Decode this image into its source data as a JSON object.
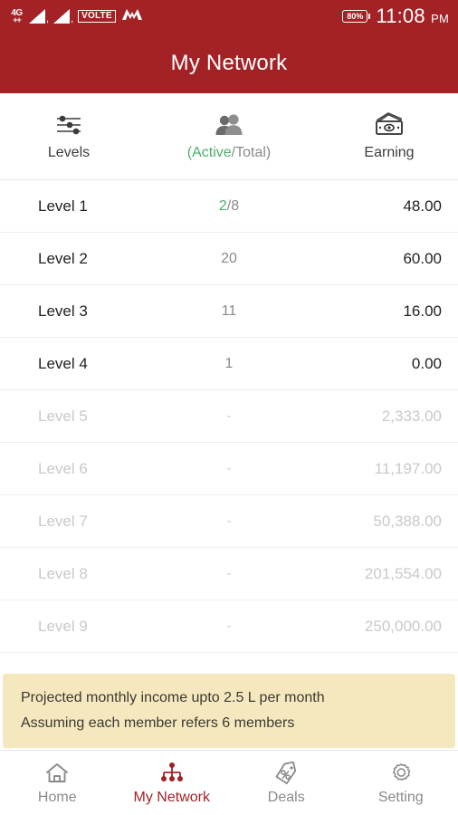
{
  "status_bar": {
    "network_type": "4G",
    "network_plus": "++",
    "volte_label": "VOLTE",
    "carrier_logo": "M",
    "battery_level": "80%",
    "time": "11:08",
    "time_period": "PM"
  },
  "header": {
    "title": "My Network"
  },
  "columns": {
    "levels": {
      "label": "Levels",
      "icon": "sliders-icon"
    },
    "active_total": {
      "active_label": "(Active",
      "total_label": "/Total)",
      "icon": "people-icon"
    },
    "earning": {
      "label": "Earning",
      "icon": "money-icon"
    }
  },
  "rows": [
    {
      "level": "Level 1",
      "count": "2",
      "count_sep": "/8",
      "earning": "48.00",
      "locked": false,
      "has_chevron": true
    },
    {
      "level": "Level 2",
      "count": "20",
      "count_sep": "",
      "earning": "60.00",
      "locked": false,
      "has_chevron": false
    },
    {
      "level": "Level 3",
      "count": "11",
      "count_sep": "",
      "earning": "16.00",
      "locked": false,
      "has_chevron": false
    },
    {
      "level": "Level 4",
      "count": "1",
      "count_sep": "",
      "earning": "0.00",
      "locked": false,
      "has_chevron": false
    },
    {
      "level": "Level 5",
      "count": "-",
      "count_sep": "",
      "earning": "2,333.00",
      "locked": true,
      "has_chevron": false
    },
    {
      "level": "Level 6",
      "count": "-",
      "count_sep": "",
      "earning": "11,197.00",
      "locked": true,
      "has_chevron": false
    },
    {
      "level": "Level 7",
      "count": "-",
      "count_sep": "",
      "earning": "50,388.00",
      "locked": true,
      "has_chevron": false
    },
    {
      "level": "Level 8",
      "count": "-",
      "count_sep": "",
      "earning": "201,554.00",
      "locked": true,
      "has_chevron": false
    },
    {
      "level": "Level 9",
      "count": "-",
      "count_sep": "",
      "earning": "250,000.00",
      "locked": true,
      "has_chevron": false
    }
  ],
  "note": {
    "line1": "Projected monthly income upto 2.5 L per month",
    "line2": "Assuming each member refers 6 members"
  },
  "bottom_nav": [
    {
      "label": "Home",
      "icon": "home-icon",
      "active": false
    },
    {
      "label": "My Network",
      "icon": "network-tree-icon",
      "active": true
    },
    {
      "label": "Deals",
      "icon": "tag-percent-icon",
      "active": false
    },
    {
      "label": "Setting",
      "icon": "gear-icon",
      "active": false
    }
  ],
  "colors": {
    "brand_red": "#A22226",
    "active_green": "#4CAE6A",
    "chevron_blue": "#2E7BD6",
    "note_yellow": "#F6E8BE",
    "locked_gray": "#C9C9C9"
  }
}
